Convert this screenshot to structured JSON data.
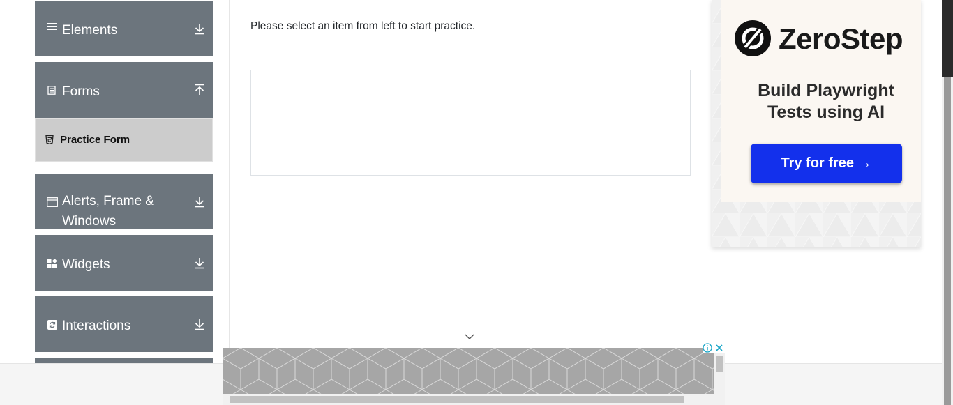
{
  "sidebar": {
    "groups": [
      {
        "label": "Elements",
        "icon": "list-icon",
        "toggle": "expand-down-icon"
      },
      {
        "label": "Forms",
        "icon": "form-icon",
        "toggle": "collapse-up-icon"
      },
      {
        "label": "Alerts, Frame & Windows",
        "line1": "Alerts, Frame &",
        "line2": "Windows",
        "icon": "window-icon",
        "toggle": "expand-down-icon"
      },
      {
        "label": "Widgets",
        "icon": "widgets-icon",
        "toggle": "expand-down-icon"
      },
      {
        "label": "Interactions",
        "icon": "interactions-icon",
        "toggle": "expand-down-icon"
      }
    ],
    "forms_items": [
      {
        "label": "Practice Form",
        "icon": "html5-icon",
        "active": true
      }
    ]
  },
  "main": {
    "instruction": "Please select an item from left to start practice."
  },
  "ad_right": {
    "brand": "ZeroStep",
    "headline_line1": "Build Playwright",
    "headline_line2": "Tests using AI",
    "cta": "Try for free →"
  },
  "colors": {
    "group_bg": "#6c757d",
    "active_item_bg": "#cccccc",
    "cta_blue": "#1330ec"
  }
}
